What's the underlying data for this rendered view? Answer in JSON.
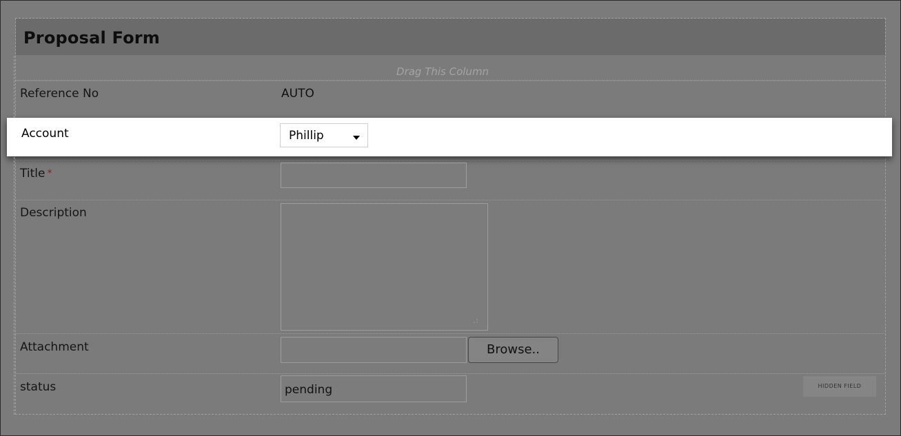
{
  "form": {
    "title": "Proposal Form",
    "drag_hint": "Drag This Column"
  },
  "fields": {
    "reference": {
      "label": "Reference No",
      "value": "AUTO"
    },
    "account": {
      "label": "Account",
      "selected": "Phillip"
    },
    "title": {
      "label": "Title",
      "required_marker": "*",
      "value": ""
    },
    "description": {
      "label": "Description",
      "value": ""
    },
    "attachment": {
      "label": "Attachment",
      "browse_label": "Browse..",
      "value": ""
    },
    "status": {
      "label": "status",
      "value": "pending",
      "badge": "HIDDEN FIELD"
    }
  },
  "colors": {
    "overlay": "#7b7b7b",
    "highlight": "#ffffff",
    "required": "#8c1d1d"
  },
  "icons": {
    "dropdown": "chevron-down-icon",
    "resize": "resize-grip-icon"
  }
}
